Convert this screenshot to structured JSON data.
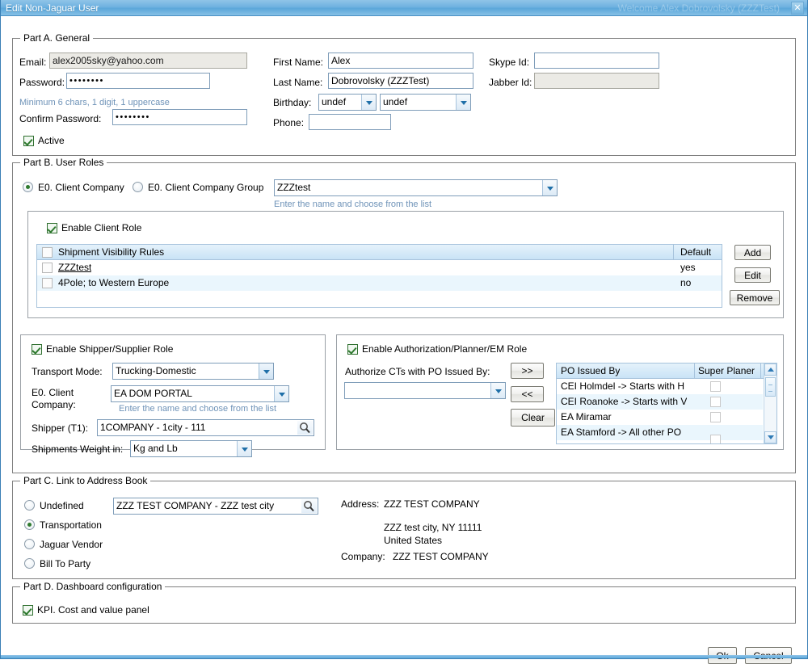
{
  "window": {
    "title": "Edit Non-Jaguar User",
    "subtitle": "Welcome Alex Dobrovolsky (ZZZTest)",
    "close_label": "✕"
  },
  "part_a": {
    "legend": "Part A. General",
    "email_label": "Email:",
    "email_value": "alex2005sky@yahoo.com",
    "password_label": "Password:",
    "password_value": "••••••••",
    "password_hint": "Minimum 6 chars, 1 digit, 1 uppercase",
    "confirm_label": "Confirm Password:",
    "confirm_value": "••••••••",
    "active_label": "Active",
    "active_checked": true,
    "first_name_label": "First Name:",
    "first_name_value": "Alex",
    "last_name_label": "Last Name:",
    "last_name_value": "Dobrovolsky (ZZZTest)",
    "birthday_label": "Birthday:",
    "birthday_month": "undef",
    "birthday_day": "undef",
    "phone_label": "Phone:",
    "phone_value": "",
    "skype_label": "Skype Id:",
    "skype_value": "",
    "jabber_label": "Jabber Id:",
    "jabber_value": ""
  },
  "part_b": {
    "legend": "Part B. User Roles",
    "radio_company_label": "E0. Client Company",
    "radio_company_selected": true,
    "radio_group_label": "E0. Client Company Group",
    "company_value": "ZZZtest",
    "company_hint": "Enter the name and choose from the list",
    "client_role": {
      "enable_label": "Enable Client Role",
      "enable_checked": true,
      "columns": [
        "Shipment Visibility Rules",
        "Default"
      ],
      "rows": [
        {
          "name": "ZZZtest",
          "default": "yes",
          "checked": false
        },
        {
          "name": "4Pole; to Western Europe",
          "default": "no",
          "checked": false
        }
      ],
      "buttons": {
        "add": "Add",
        "edit": "Edit",
        "remove": "Remove"
      }
    },
    "shipper_role": {
      "enable_label": "Enable Shipper/Supplier Role",
      "enable_checked": true,
      "transport_mode_label": "Transport Mode:",
      "transport_mode_value": "Trucking-Domestic",
      "client_company_label_l1": "E0. Client",
      "client_company_label_l2": "Company:",
      "client_company_value": "EA DOM PORTAL",
      "client_company_hint": "Enter the name and choose from the list",
      "shipper_label": "Shipper (T1):",
      "shipper_value": "1COMPANY - 1city - 111",
      "weight_label": "Shipments Weight in:",
      "weight_value": "Kg and Lb"
    },
    "auth_role": {
      "enable_label": "Enable Authorization/Planner/EM Role",
      "enable_checked": true,
      "authorize_label": "Authorize CTs with PO Issued By:",
      "authorize_value": "",
      "btn_add": ">>",
      "btn_remove": "<<",
      "btn_clear": "Clear",
      "columns": [
        "PO Issued By",
        "Super Planer"
      ],
      "rows": [
        {
          "name": "CEI Holmdel -> Starts with H",
          "super_planer": false
        },
        {
          "name": "CEI Roanoke -> Starts with V",
          "super_planer": false
        },
        {
          "name": "EA Miramar",
          "super_planer": false
        },
        {
          "name": "EA Stamford -> All other PO",
          "super_planer": false
        }
      ]
    }
  },
  "part_c": {
    "legend": "Part C. Link to Address Book",
    "options": [
      {
        "label": "Undefined",
        "selected": false
      },
      {
        "label": "Transportation",
        "selected": true
      },
      {
        "label": "Jaguar Vendor",
        "selected": false
      },
      {
        "label": "Bill To Party",
        "selected": false
      }
    ],
    "search_value": "ZZZ TEST COMPANY - ZZZ test city",
    "address_label": "Address:",
    "address_line1": "ZZZ TEST COMPANY",
    "address_line2": "ZZZ test city, NY 11111",
    "address_line3": "United States",
    "company_label": "Company:",
    "company_value": "ZZZ TEST COMPANY"
  },
  "part_d": {
    "legend": "Part D. Dashboard configuration",
    "kpi_label": "KPI. Cost and value panel",
    "kpi_checked": true
  },
  "footer": {
    "ok_label": "Ok",
    "cancel_label": "Cancel"
  },
  "colors": {
    "title_bar": "#6fb2e0",
    "hint_text": "#6f93b8",
    "table_header": "#c9e3f6",
    "row_alt": "#eaf6fd"
  }
}
